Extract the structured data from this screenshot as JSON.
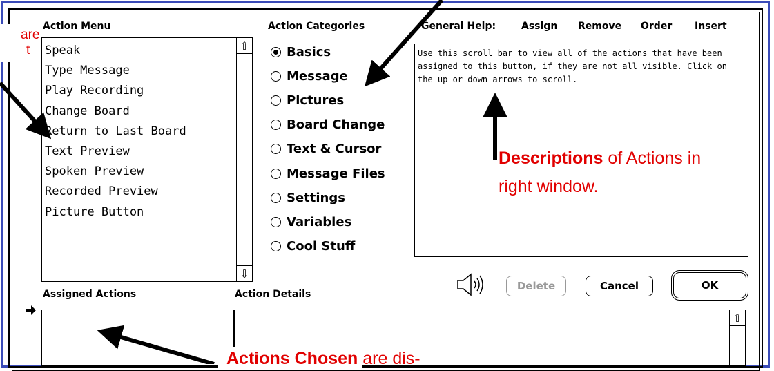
{
  "headers": {
    "action_menu": "Action Menu",
    "action_categories": "Action Categories",
    "general_help": "General Help:",
    "assign": "Assign",
    "remove": "Remove",
    "order": "Order",
    "insert": "Insert",
    "assigned_actions": "Assigned Actions",
    "action_details": "Action Details"
  },
  "action_menu_items": [
    "Speak",
    "Type Message",
    "Play Recording",
    "Change Board",
    "Return to Last Board",
    "Text Preview",
    "Spoken Preview",
    "Recorded Preview",
    "Picture Button"
  ],
  "categories": [
    {
      "label": "Basics",
      "selected": true
    },
    {
      "label": "Message",
      "selected": false
    },
    {
      "label": "Pictures",
      "selected": false
    },
    {
      "label": "Board Change",
      "selected": false
    },
    {
      "label": "Text & Cursor",
      "selected": false
    },
    {
      "label": "Message Files",
      "selected": false
    },
    {
      "label": "Settings",
      "selected": false
    },
    {
      "label": "Variables",
      "selected": false
    },
    {
      "label": "Cool Stuff",
      "selected": false
    }
  ],
  "help_text": "Use this scroll bar to view all of the actions that have been assigned to this button, if they are not all visible. Click on the up or down arrows to scroll.",
  "buttons": {
    "delete": "Delete",
    "cancel": "Cancel",
    "ok": "OK"
  },
  "annotations": {
    "top_left_line1": "are",
    "top_left_line2": "t",
    "descriptions_bold": "Descriptions",
    "descriptions_rest": " of Actions in",
    "descriptions_line2": "right window.",
    "chosen_bold": "Actions Chosen",
    "chosen_rest": " are dis-"
  },
  "colors": {
    "frame_blue": "#3a4bb8",
    "annotation_red": "#e10000"
  }
}
